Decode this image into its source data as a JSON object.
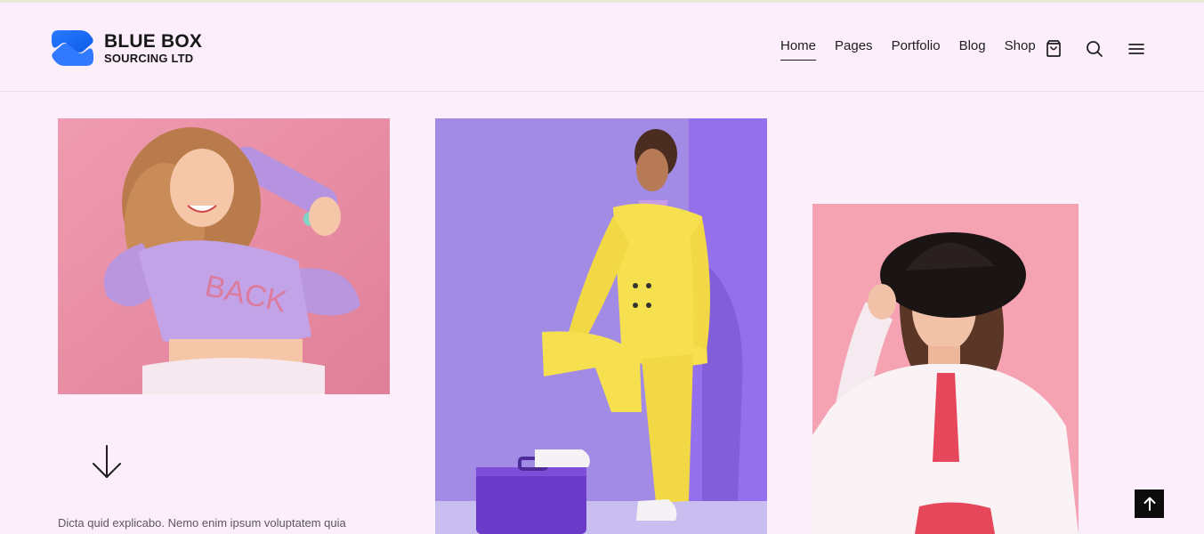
{
  "brand": {
    "name_line1": "BLUE BOX",
    "name_line2": "SOURCING LTD",
    "logo_icon": "blue-box-logo-icon",
    "logo_color": "#1f6fff"
  },
  "nav": {
    "items": [
      {
        "label": "Home",
        "active": true
      },
      {
        "label": "Pages"
      },
      {
        "label": "Portfolio"
      },
      {
        "label": "Blog"
      },
      {
        "label": "Shop"
      }
    ],
    "icons": [
      "shopping-bag-icon",
      "search-icon",
      "menu-icon"
    ]
  },
  "gallery": [
    {
      "subject": "woman-purple-hoodie-skateboard",
      "background": "#e88ea6"
    },
    {
      "subject": "woman-yellow-suit-suitcase",
      "background": "#a48be6"
    },
    {
      "subject": "woman-black-hat-white-shirt",
      "background": "#f6a4b4"
    }
  ],
  "content": {
    "scroll_icon": "arrow-down-icon",
    "paragraph": "Dicta quid explicabo. Nemo enim ipsum voluptatem quia"
  },
  "back_to_top": {
    "icon": "arrow-up-icon"
  },
  "colors": {
    "page_background": "#fdeefb",
    "text": "#1e1e1e",
    "to_top_button": "#0c0c0c"
  }
}
